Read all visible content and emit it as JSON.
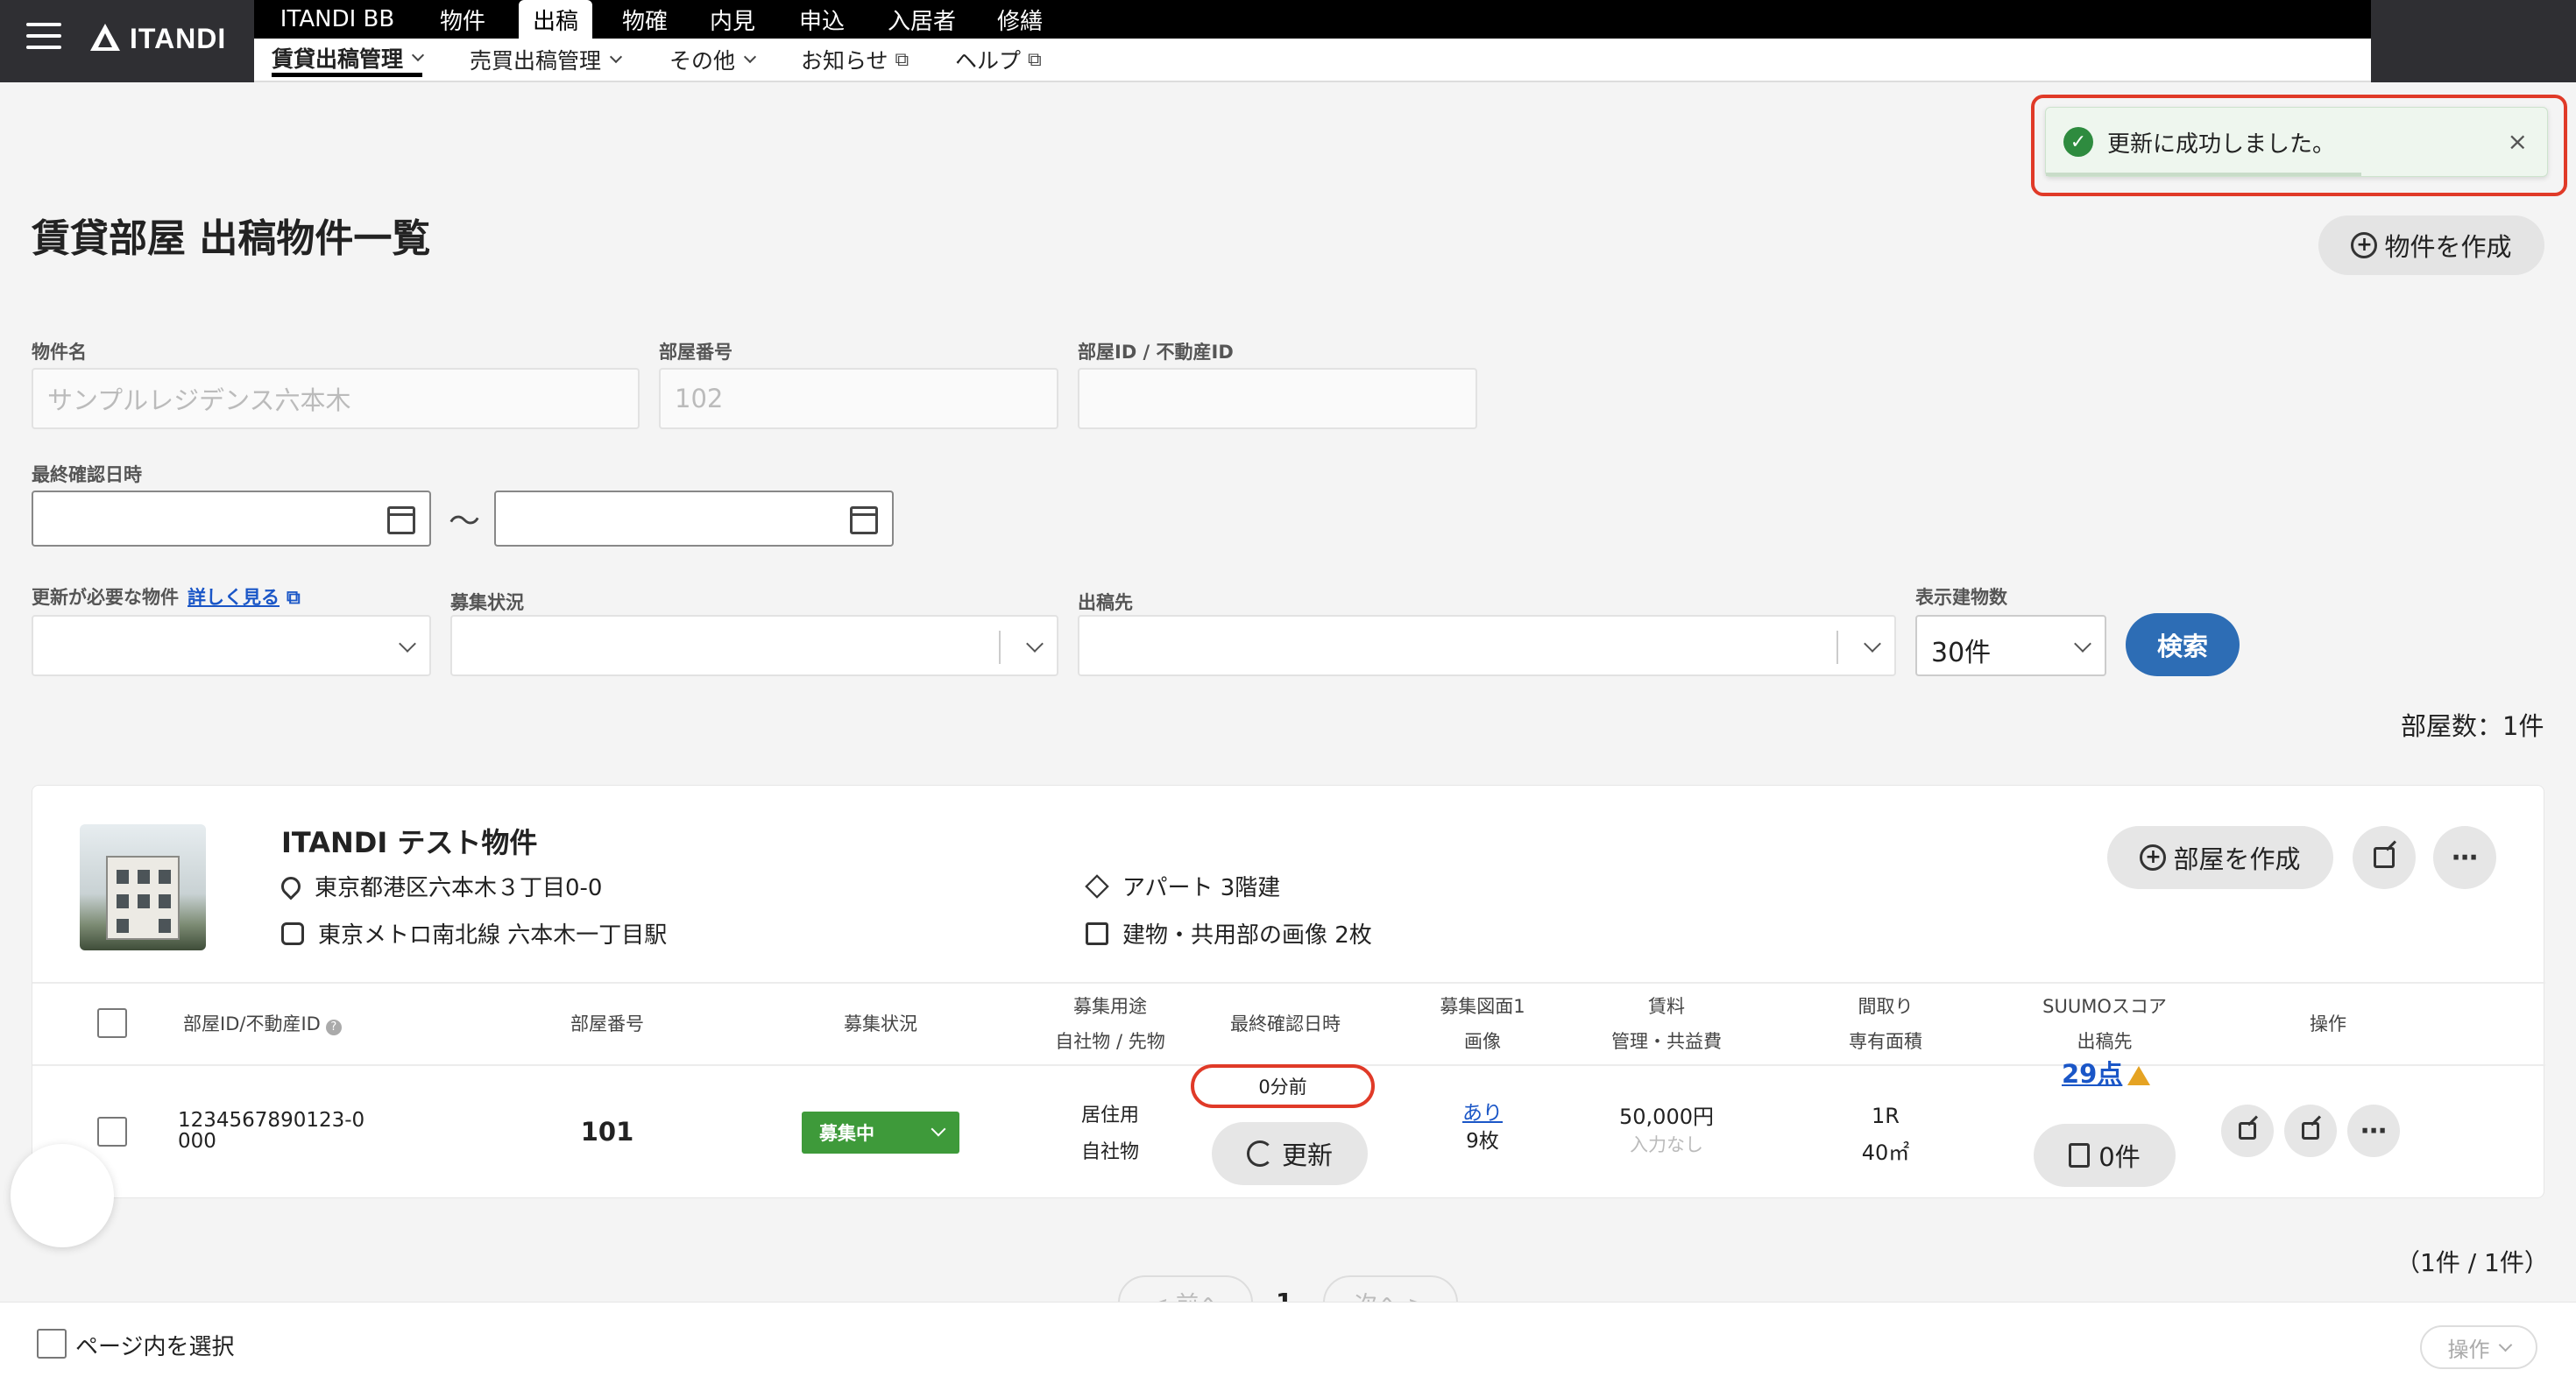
{
  "header": {
    "logo_text": "ITANDI",
    "tabs": [
      "ITANDI BB",
      "物件",
      "出稿",
      "物確",
      "内見",
      "申込",
      "入居者",
      "修繕"
    ],
    "active_tab": "出稿",
    "subtabs": {
      "rental": "賃貸出稿管理",
      "sale": "売買出稿管理",
      "other": "その他",
      "news": "お知らせ",
      "help": "ヘルプ"
    }
  },
  "toast": {
    "message": "更新に成功しました。",
    "close": "×"
  },
  "page": {
    "title": "賃貸部屋 出稿物件一覧",
    "create_button": "物件を作成"
  },
  "search": {
    "property_name_label": "物件名",
    "property_name_placeholder": "サンプルレジデンス六本木",
    "room_number_label": "部屋番号",
    "room_number_placeholder": "102",
    "room_id_label": "部屋ID / 不動産ID",
    "last_check_label": "最終確認日時",
    "tilde": "〜",
    "needs_update_label": "更新が必要な物件",
    "detail_link": "詳しく見る",
    "recruit_status_label": "募集状況",
    "publish_target_label": "出稿先",
    "display_count_label": "表示建物数",
    "display_count_value": "30件",
    "search_button": "検索",
    "room_count": "部屋数：1件"
  },
  "property": {
    "name": "ITANDI テスト物件",
    "address": "東京都港区六本木３丁目0-0",
    "station": "東京メトロ南北線 六本木一丁目駅",
    "building_type": "アパート 3階建",
    "images": "建物・共用部の画像 2枚",
    "create_room_button": "部屋を作成"
  },
  "table": {
    "headers": {
      "room_id": "部屋ID/不動産ID",
      "room_number": "部屋番号",
      "status": "募集状況",
      "usage_1": "募集用途",
      "usage_2": "自社物 / 先物",
      "last_check": "最終確認日時",
      "floorplan_1": "募集図面1",
      "floorplan_2": "画像",
      "rent_1": "賃料",
      "rent_2": "管理・共益費",
      "layout_1": "間取り",
      "layout_2": "専有面積",
      "suumo_1": "SUUMOスコア",
      "suumo_2": "出稿先",
      "ops": "操作"
    },
    "row": {
      "room_id": "1234567890123-0000",
      "room_number": "101",
      "status": "募集中",
      "usage": "居住用",
      "ownership": "自社物",
      "last_check_ago": "0分前",
      "update_button": "更新",
      "floorplan_link": "あり",
      "image_count": "9枚",
      "rent": "50,000円",
      "fee": "入力なし",
      "layout": "1R",
      "area": "40㎡",
      "suumo_score": "29点",
      "publish_count": "0件"
    }
  },
  "pagination": {
    "summary": "（1件 / 1件）",
    "prev": "< 前へ",
    "current": "1",
    "next": "次へ >"
  },
  "bottom": {
    "select_page": "ページ内を選択",
    "action": "操作"
  }
}
